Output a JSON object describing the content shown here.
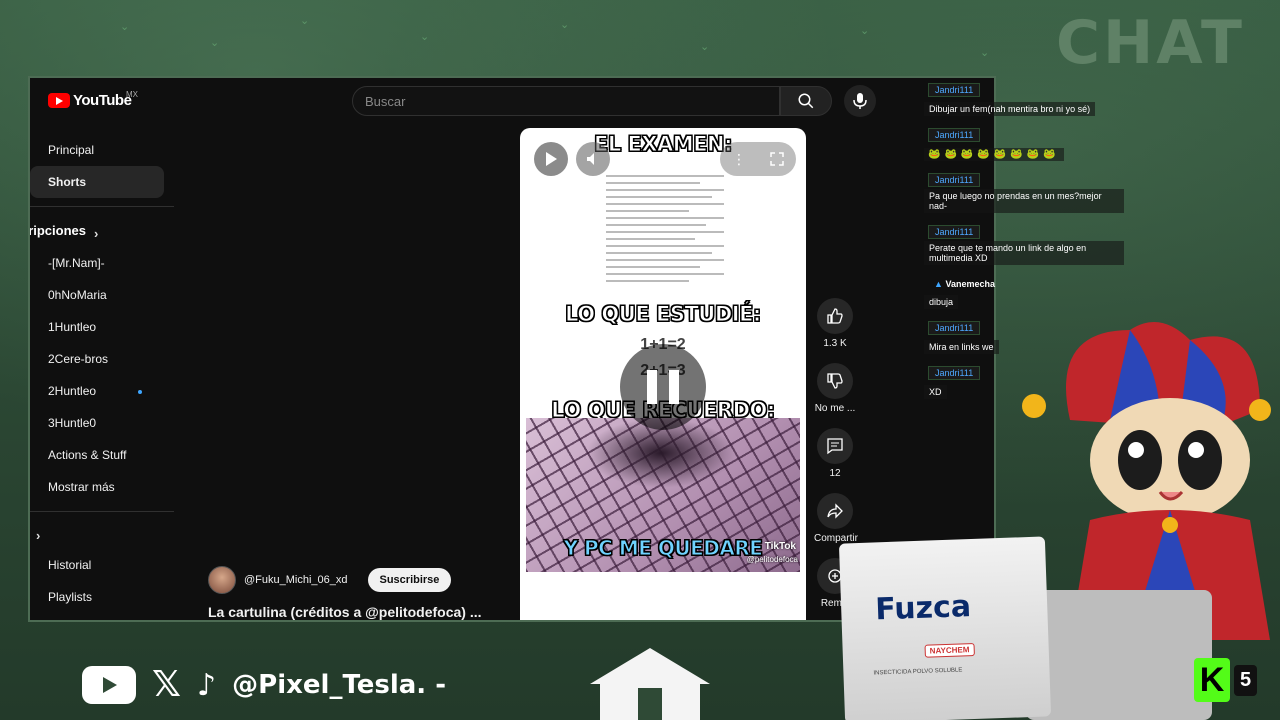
{
  "overlay": {
    "chat_title": "CHAT",
    "handle": "@Pixel_Tesla. -",
    "kick_count": "5"
  },
  "youtube": {
    "logo_text": "YouTube",
    "region": "MX",
    "search_placeholder": "Buscar",
    "sidebar": {
      "main": [
        {
          "label": "Principal",
          "active": false
        },
        {
          "label": "Shorts",
          "active": true
        }
      ],
      "subscriptions_heading": "Suscripciones",
      "subscriptions": [
        {
          "label": "-[Mr.Nam]-"
        },
        {
          "label": "0hNoMaria"
        },
        {
          "label": "1Huntleo"
        },
        {
          "label": "2Cere-bros"
        },
        {
          "label": "2Huntleo"
        },
        {
          "label": "3Huntle0"
        },
        {
          "label": "Actions & Stuff"
        },
        {
          "label": "Mostrar más"
        }
      ],
      "you": [
        {
          "label": "Historial"
        },
        {
          "label": "Playlists"
        }
      ]
    },
    "short": {
      "text_top": "EL EXAMEN:",
      "text_middle": "LO QUE ESTUDIÉ:",
      "math_1": "1+1=2",
      "math_2": "2+1=3",
      "text_lower": "LO QUE RECUERDO:",
      "text_bottom": "Y PC ME QUEDARE",
      "tiktok_tag": "TikTok",
      "tiktok_handle": "@pelitodefoca"
    },
    "actions": {
      "like_count": "1.3 K",
      "dislike_label": "No me ...",
      "comments_count": "12",
      "share_label": "Compartir",
      "remix_label": "Remix"
    },
    "channel_name": "@Fuku_Michi_06_xd",
    "subscribe_label": "Suscribirse",
    "video_title": "La cartulina (créditos a @pelitodefoca) ..."
  },
  "chat": {
    "messages": [
      {
        "user": "Jandri111",
        "text": "Dibujar un fem(nah mentira bro ni yo sé)"
      },
      {
        "user": "Jandri111",
        "emotes": "🐸🐸🐸🐸🐸🐸🐸🐸"
      },
      {
        "user": "Jandri111",
        "text": "Pa que luego no prendas en un mes?mejor nad-"
      },
      {
        "user": "Jandri111",
        "text": "Perate que te mando un link de algo en multimedia XD"
      },
      {
        "user": "Vanemecha",
        "text": "dibuja"
      },
      {
        "user": "Jandri111",
        "text": "Mira en links we"
      },
      {
        "user": "Jandri111",
        "text": "XD"
      }
    ]
  },
  "product": {
    "brand": "Fuzca",
    "maker": "NAYCHEM",
    "type": "INSECTICIDA POLVO SOLUBLE"
  }
}
